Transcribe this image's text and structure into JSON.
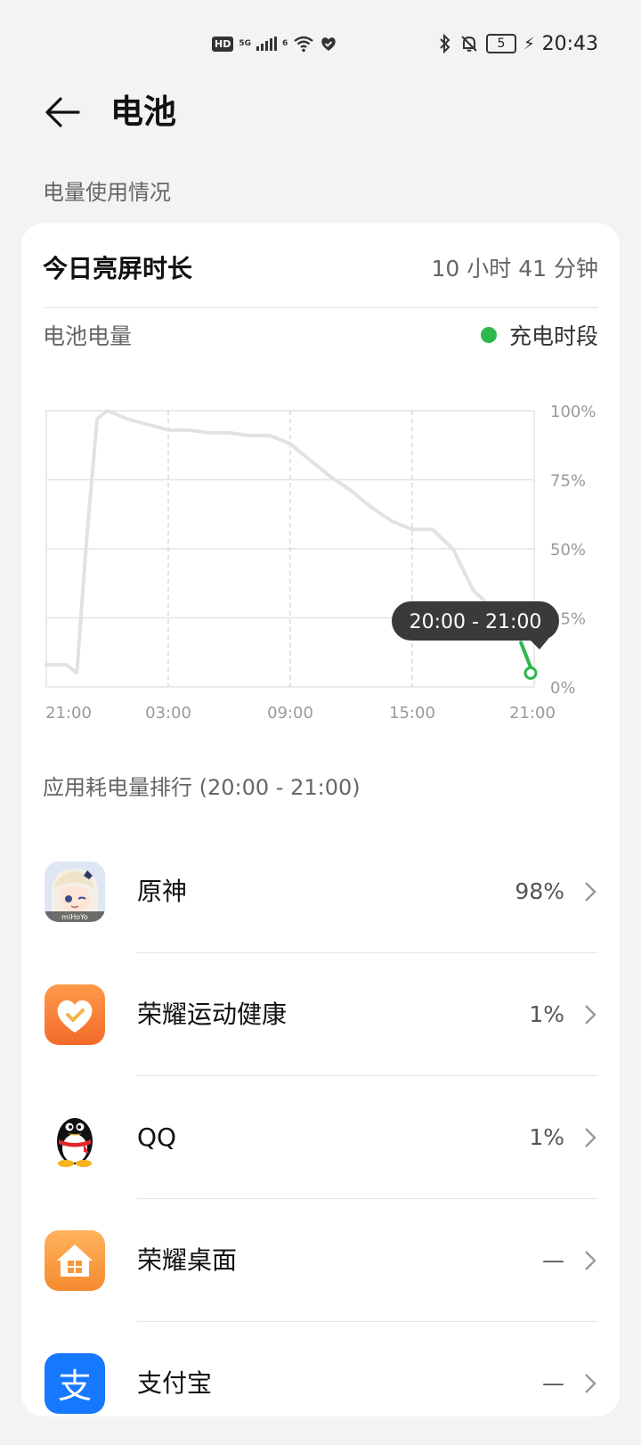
{
  "status_bar": {
    "network_badge": "HD",
    "network_5g": "5G",
    "wifi_6": "6",
    "battery_level": "5",
    "time": "20:43",
    "icons": [
      "hd-icon",
      "signal-icon",
      "wifi-icon",
      "heart-shield-icon",
      "bluetooth-icon",
      "mute-icon",
      "battery-icon",
      "charging-icon"
    ]
  },
  "header": {
    "title": "电池"
  },
  "section": {
    "label": "电量使用情况"
  },
  "card": {
    "screen_time_label": "今日亮屏时长",
    "screen_time_value": "10 小时 41 分钟",
    "battery_label": "电池电量",
    "legend_label": "充电时段",
    "accent": "#2db84d"
  },
  "chart_data": {
    "type": "line",
    "y_tick_labels": [
      "100%",
      "75%",
      "50%",
      "25%",
      "0%"
    ],
    "x_tick_labels": [
      "21:00",
      "03:00",
      "09:00",
      "15:00",
      "21:00"
    ],
    "ylim": [
      0,
      100
    ],
    "tooltip": "20:00 - 21:00",
    "series": [
      {
        "x": [
          "21:00",
          "22:00",
          "22:30",
          "23:00",
          "23:30",
          "00:00",
          "01:00",
          "02:00",
          "03:00",
          "04:00",
          "05:00",
          "06:00",
          "07:00",
          "08:00",
          "09:00",
          "10:00",
          "11:00",
          "12:00",
          "13:00",
          "14:00",
          "15:00",
          "16:00",
          "17:00",
          "18:00",
          "19:00",
          "20:00"
        ],
        "values": [
          8,
          8,
          5,
          55,
          97,
          100,
          97,
          95,
          93,
          93,
          92,
          92,
          91,
          91,
          88,
          82,
          76,
          71,
          65,
          60,
          57,
          57,
          50,
          35,
          28,
          22
        ]
      },
      {
        "x": [
          "20:00",
          "20:30",
          "21:00"
        ],
        "values": [
          16,
          5,
          5
        ],
        "charging": true
      }
    ]
  },
  "ranking": {
    "title": "应用耗电量排行 (20:00 - 21:00)",
    "apps": [
      {
        "name": "原神",
        "value": "98%"
      },
      {
        "name": "荣耀运动健康",
        "value": "1%"
      },
      {
        "name": "QQ",
        "value": "1%"
      },
      {
        "name": "荣耀桌面",
        "value": "—"
      },
      {
        "name": "支付宝",
        "value": "—"
      }
    ]
  }
}
